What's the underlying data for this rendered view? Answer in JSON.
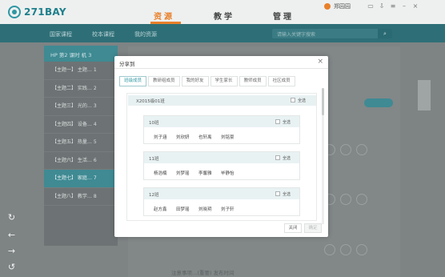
{
  "app": {
    "logo_text": "271BAY"
  },
  "header": {
    "nav": [
      {
        "label": "资源",
        "active": true
      },
      {
        "label": "教学",
        "active": false
      },
      {
        "label": "管理",
        "active": false
      }
    ],
    "user_name": "郑园园"
  },
  "subnav": {
    "items": [
      "国家课程",
      "校本课程",
      "我的资源"
    ],
    "search_placeholder": "请输入关键字搜索"
  },
  "sidebar": {
    "header": "HP 第2 课时 机 3",
    "items": [
      "【主题一】 主题… 1",
      "【主题二】 实践… 2",
      "【主题三】 光的… 3",
      "【主题四】 设备… 4",
      "【主题五】 热量… 5",
      "【主题六】 生活… 6",
      "【主题七】 家庭… 7",
      "【主题八】 教学… 8"
    ],
    "selected_index": 6
  },
  "dialog": {
    "title": "分享到",
    "close_glyph": "×",
    "tabs": [
      {
        "label": "班级成员",
        "active": true
      },
      {
        "label": "教研组成员",
        "active": false
      },
      {
        "label": "我的好友",
        "active": false
      },
      {
        "label": "学生家长",
        "active": false
      },
      {
        "label": "教师成员",
        "active": false
      },
      {
        "label": "社区成员",
        "active": false
      }
    ],
    "grade": {
      "label": "X2015级01班",
      "select_all": "全选"
    },
    "classes": [
      {
        "name": "10班",
        "select_all": "全选",
        "students": [
          "刘子涵",
          "刘欣妍",
          "也轩禹",
          "刘铭豪"
        ]
      },
      {
        "name": "11班",
        "select_all": "全选",
        "students": [
          "杨浩楠",
          "刘梦瑶",
          "李馨雅",
          "毕静怡"
        ]
      },
      {
        "name": "12班",
        "select_all": "全选",
        "students": [
          "赵方鑫",
          "田梦瑶",
          "刘晓玥",
          "刘子轩"
        ]
      }
    ],
    "buttons": {
      "close": "关闭",
      "confirm": "确定"
    }
  },
  "background": {
    "footer_text": "注意事项…(重要) 发布时间"
  },
  "float_controls": [
    "refresh-icon",
    "back-icon",
    "forward-icon",
    "history-icon"
  ],
  "colors": {
    "accent": "#e8802a",
    "brand": "#2e6f77",
    "teal": "#2f97a3"
  }
}
